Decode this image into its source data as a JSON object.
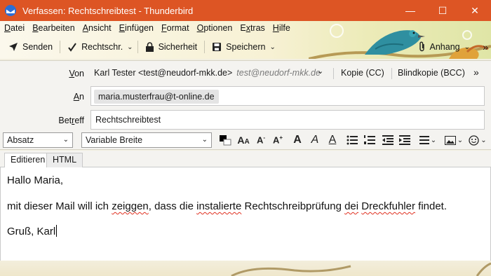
{
  "window": {
    "title": "Verfassen: Rechtschreibtest - Thunderbird",
    "controls": {
      "minimize": "—",
      "maximize": "☐",
      "close": "✕"
    }
  },
  "menu": [
    {
      "name": "datei",
      "pre": "",
      "acc": "D",
      "post": "atei"
    },
    {
      "name": "bearbeiten",
      "pre": "",
      "acc": "B",
      "post": "earbeiten"
    },
    {
      "name": "ansicht",
      "pre": "",
      "acc": "A",
      "post": "nsicht"
    },
    {
      "name": "einfuegen",
      "pre": "",
      "acc": "E",
      "post": "infügen"
    },
    {
      "name": "format",
      "pre": "",
      "acc": "F",
      "post": "ormat"
    },
    {
      "name": "optionen",
      "pre": "",
      "acc": "O",
      "post": "ptionen"
    },
    {
      "name": "extras",
      "pre": "E",
      "acc": "x",
      "post": "tras"
    },
    {
      "name": "hilfe",
      "pre": "",
      "acc": "H",
      "post": "ilfe"
    }
  ],
  "toolbar": {
    "send": "Senden",
    "spelling": "Rechtschr.",
    "security": "Sicherheit",
    "save": "Speichern",
    "attach": "Anhang",
    "overflow": "»"
  },
  "header_fields": {
    "from_label_pre": "",
    "from_label_acc": "V",
    "from_label_post": "on",
    "from_value": "Karl Tester <test@neudorf-mkk.de>",
    "from_alt": "test@neudorf-mkk.de",
    "cc": "Kopie (CC)",
    "bcc": "Blindkopie (BCC)",
    "more": "»",
    "to_label_pre": "",
    "to_label_acc": "A",
    "to_label_post": "n",
    "to_recipient": "maria.musterfrau@t-online.de",
    "subject_label_pre": "Bet",
    "subject_label_acc": "r",
    "subject_label_post": "eff",
    "subject_value": "Rechtschreibtest"
  },
  "format": {
    "paragraph_style": "Absatz",
    "font": "Variable Breite"
  },
  "tabs": {
    "edit": "Editieren",
    "html": "HTML"
  },
  "body": {
    "line1": "Hallo Maria,",
    "line2": [
      {
        "t": "mit dieser Mail will ich ",
        "err": false
      },
      {
        "t": "zeiggen",
        "err": true
      },
      {
        "t": ", dass die ",
        "err": false
      },
      {
        "t": "instalierte",
        "err": true
      },
      {
        "t": " Rechtschreibprüfung ",
        "err": false
      },
      {
        "t": "dei",
        "err": true
      },
      {
        "t": " ",
        "err": false
      },
      {
        "t": "Dreckfuhler",
        "err": true
      },
      {
        "t": " findet.",
        "err": false
      }
    ],
    "line3": "Gruß, Karl"
  },
  "colors": {
    "titlebar": "#dd5524",
    "spell_error": "#e03020"
  }
}
